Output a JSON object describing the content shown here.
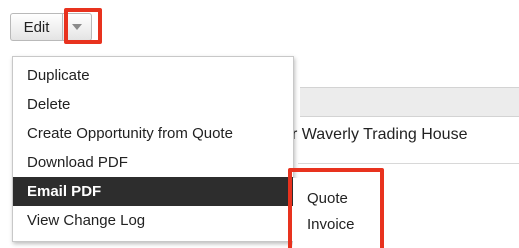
{
  "toolbar": {
    "edit_label": "Edit",
    "caret_icon": "chevron-down-icon"
  },
  "record": {
    "name_fragment": "r Waverly Trading House"
  },
  "menu": {
    "items": [
      {
        "label": "Duplicate"
      },
      {
        "label": "Delete"
      },
      {
        "label": "Create Opportunity from Quote"
      },
      {
        "label": "Download PDF"
      },
      {
        "label": "Email PDF",
        "active": true
      },
      {
        "label": "View Change Log"
      }
    ]
  },
  "submenu": {
    "items": [
      {
        "label": "Quote"
      },
      {
        "label": "Invoice"
      }
    ]
  },
  "colors": {
    "highlight": "#e8321e",
    "active_bg": "#2d2d2d"
  }
}
